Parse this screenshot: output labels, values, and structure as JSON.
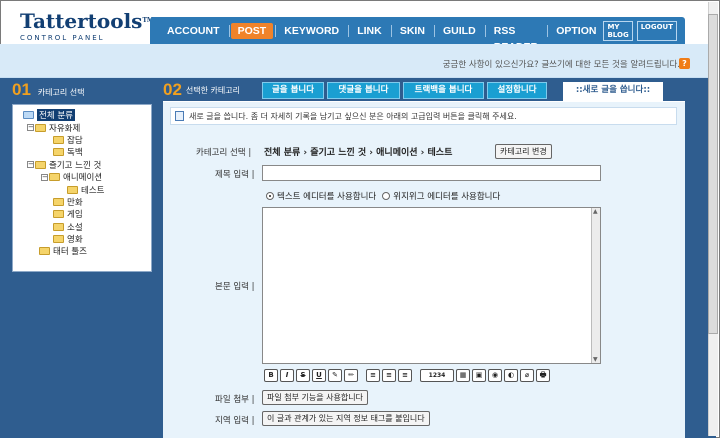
{
  "header": {
    "logo_main": "Tattertools",
    "logo_tm": "TM",
    "logo_sub": "CONTROL PANEL",
    "nav": [
      "ACCOUNT",
      "POST",
      "KEYWORD",
      "LINK",
      "SKIN",
      "GUILD",
      "RSS READER",
      "OPTION"
    ],
    "active_nav": "POST",
    "my_blog": "MY BLOG",
    "logout": "LOGOUT"
  },
  "notice": "궁금한 사항이 있으신가요? 글쓰기에 대한 모든 것을 알려드립니다.",
  "left": {
    "num": "01",
    "label": "카테고리 선택",
    "tree": [
      {
        "label": "전체 분류",
        "selected": true
      },
      {
        "label": "자유화제"
      },
      {
        "label": "잡담"
      },
      {
        "label": "독백"
      },
      {
        "label": "즐기고 느낀 것"
      },
      {
        "label": "애니메이션"
      },
      {
        "label": "테스트"
      },
      {
        "label": "만화"
      },
      {
        "label": "게임"
      },
      {
        "label": "소설"
      },
      {
        "label": "영화"
      },
      {
        "label": "태터 툴즈"
      }
    ]
  },
  "right": {
    "num": "02",
    "label": "선택한 카테고리",
    "tabs": [
      "글을 봅니다",
      "댓글을 봅니다",
      "트랙백을 봅니다",
      "설정합니다",
      "::새로 글을 씁니다::"
    ],
    "info": "새로 글을 씁니다. 좀 더 자세히 기록을 남기고 싶으신 분은 아래의 고급입력 버튼을 클릭해 주세요.",
    "category_label": "카테고리 선택 |",
    "category_path": "전체 분류 › 즐기고 느낀 것 › 애니메이션 › 테스트",
    "category_button": "카테고리 변경",
    "title_label": "제목 입력 |",
    "title_value": "",
    "editor_text": "텍스트 에디터를 사용합니다",
    "editor_wysiwyg": "위지위그 에디터를 사용합니다",
    "body_label": "본문 입력 |",
    "body_value": "",
    "toolbar": [
      "B",
      "I",
      "S",
      "U",
      "✎",
      "✏",
      "≡",
      "≡",
      "≡",
      "1234",
      "▦",
      "▣",
      "◉",
      "◐",
      "⌀",
      "🖶"
    ],
    "file_label": "파일 첨부 |",
    "file_button": "파일 첨부 기능을 사용합니다",
    "location_label": "지역 입력 |",
    "location_button": "이 글과 관계가 있는 지역 정보 태그를 붙입니다"
  }
}
